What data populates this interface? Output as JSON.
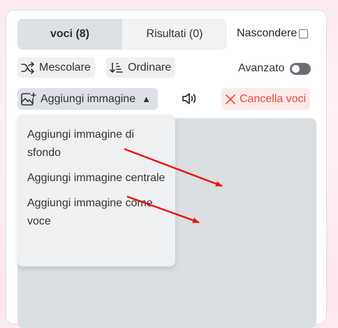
{
  "tabs": [
    {
      "label": "voci (8)",
      "active": true
    },
    {
      "label": "Risultati (0)",
      "active": false
    }
  ],
  "hide_label": "Nascondere",
  "hide_checked": false,
  "toolbar": {
    "shuffle_label": "Mescolare",
    "sort_label": "Ordinare",
    "advanced_label": "Avanzato",
    "advanced_on": false,
    "add_image_label": "Aggiungi immagine",
    "clear_label": "Cancella voci"
  },
  "dropdown": {
    "items": [
      {
        "label": "Aggiungi immagine di sfondo"
      },
      {
        "label": "Aggiungi immagine centrale"
      },
      {
        "label": "Aggiungi immagine come voce"
      }
    ]
  },
  "colors": {
    "accent_red": "#e84a3a",
    "annotation_arrow": "#ee1111",
    "active_tab_bg": "#dde1e6"
  },
  "icons": {
    "shuffle": "shuffle-icon",
    "sort": "sort-icon",
    "add_image": "add-image-icon",
    "caret": "caret-up-icon",
    "speaker": "speaker-icon",
    "clear": "close-icon"
  }
}
